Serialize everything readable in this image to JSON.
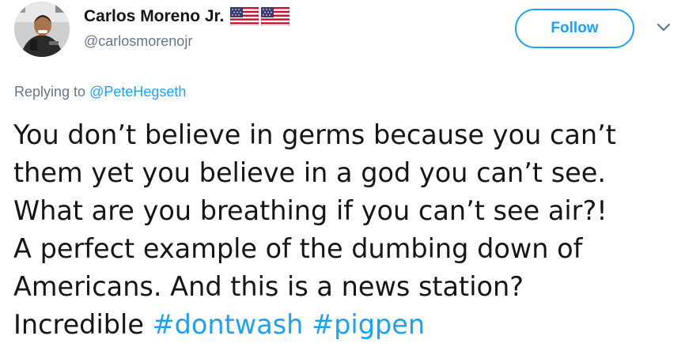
{
  "tweet": {
    "author": {
      "display_name": "Carlos Moreno Jr.",
      "handle": "@carlosmorenojr",
      "flags": [
        "us-flag-icon",
        "us-flag-icon"
      ]
    },
    "follow_label": "Follow",
    "menu_icon": "chevron-down-icon",
    "reply": {
      "prefix": "Replying to",
      "mention": "@PeteHegseth"
    },
    "lines": [
      "You don’t believe in germs because you can’t",
      "them yet you believe in a god you can’t see.",
      "What are you breathing if you can’t see air?!",
      "A perfect example of the dumbing down of",
      "Americans.  And this is a news station?",
      "Incredible"
    ],
    "hashtags": [
      "#dontwash",
      "#pigpen"
    ]
  },
  "colors": {
    "accent": "#1da1f2",
    "text": "#14171a",
    "secondary": "#657786"
  }
}
